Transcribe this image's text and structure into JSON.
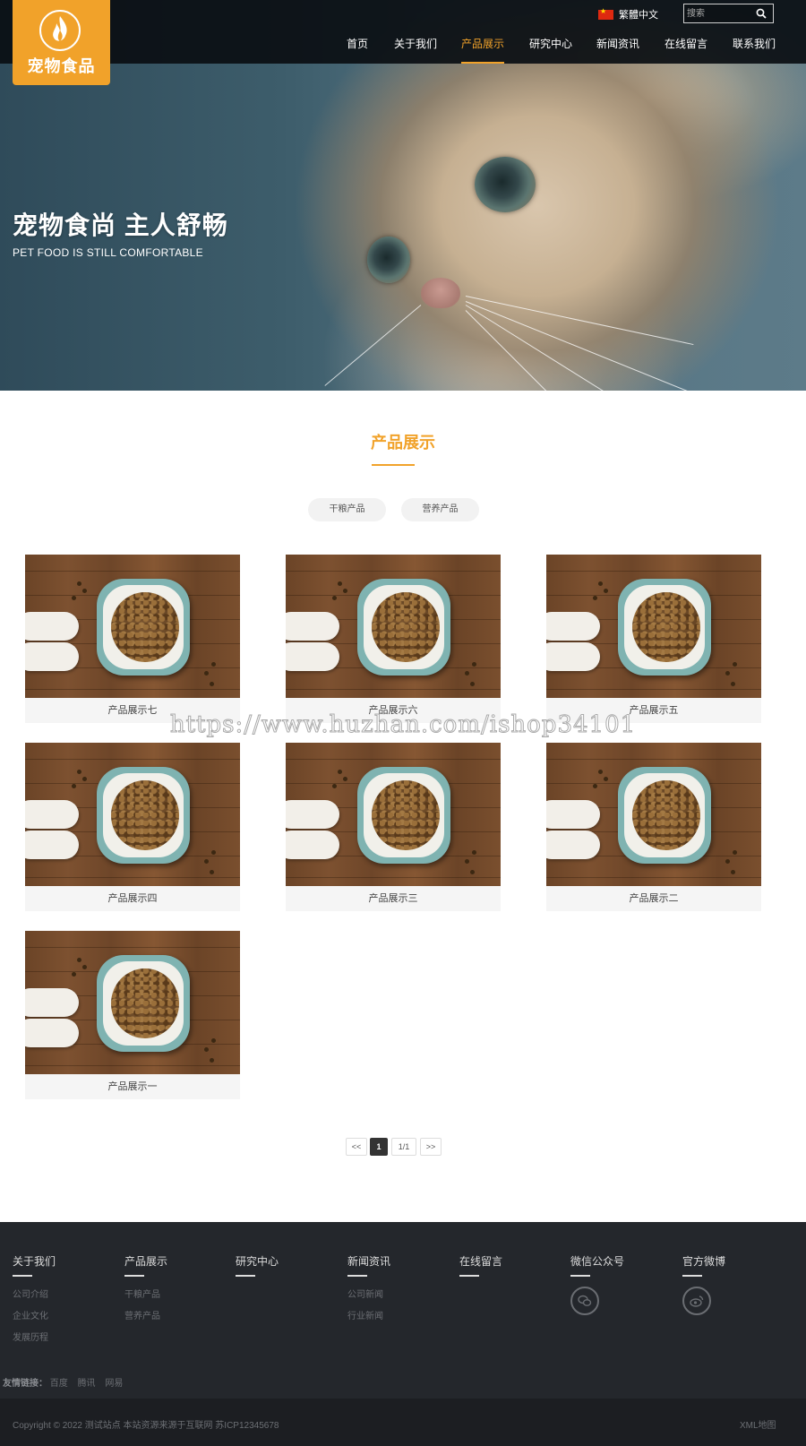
{
  "header": {
    "logo_text": "宠物食品",
    "language": "繁體中文",
    "search_placeholder": "搜索",
    "nav": [
      {
        "label": "首页"
      },
      {
        "label": "关于我们"
      },
      {
        "label": "产品展示",
        "active": true
      },
      {
        "label": "研究中心"
      },
      {
        "label": "新闻资讯"
      },
      {
        "label": "在线留言"
      },
      {
        "label": "联系我们"
      }
    ]
  },
  "hero": {
    "title": "宠物食尚 主人舒畅",
    "subtitle": "PET FOOD IS STILL COMFORTABLE"
  },
  "products_section": {
    "title": "产品展示",
    "categories": [
      "干粮产品",
      "营养产品"
    ],
    "items": [
      {
        "name": "产品展示七"
      },
      {
        "name": "产品展示六"
      },
      {
        "name": "产品展示五"
      },
      {
        "name": "产品展示四"
      },
      {
        "name": "产品展示三"
      },
      {
        "name": "产品展示二"
      },
      {
        "name": "产品展示一"
      }
    ]
  },
  "watermark": "https://www.huzhan.com/ishop34101",
  "pagination": {
    "prev": "<<",
    "current": "1",
    "total": "1/1",
    "next": ">>"
  },
  "footer": {
    "columns": [
      {
        "title": "关于我们",
        "links": [
          "公司介绍",
          "企业文化",
          "发展历程"
        ]
      },
      {
        "title": "产品展示",
        "links": [
          "干粮产品",
          "营养产品"
        ]
      },
      {
        "title": "研究中心",
        "links": []
      },
      {
        "title": "新闻资讯",
        "links": [
          "公司新闻",
          "行业新闻"
        ]
      },
      {
        "title": "在线留言",
        "links": []
      },
      {
        "title": "微信公众号",
        "icon": "wechat-icon"
      },
      {
        "title": "官方微博",
        "icon": "weibo-icon"
      }
    ],
    "friend_links_label": "友情链接：",
    "friend_links": [
      "百度",
      "腾讯",
      "网易"
    ],
    "copyright": "Copyright © 2022 测试站点 本站资源来源于互联网 苏ICP12345678",
    "xml_link": "XML地图"
  },
  "colors": {
    "accent": "#f1a22a",
    "topbar": "#0a0e12",
    "footer_bg": "#24272c",
    "copyright_bg": "#1c1e22"
  }
}
